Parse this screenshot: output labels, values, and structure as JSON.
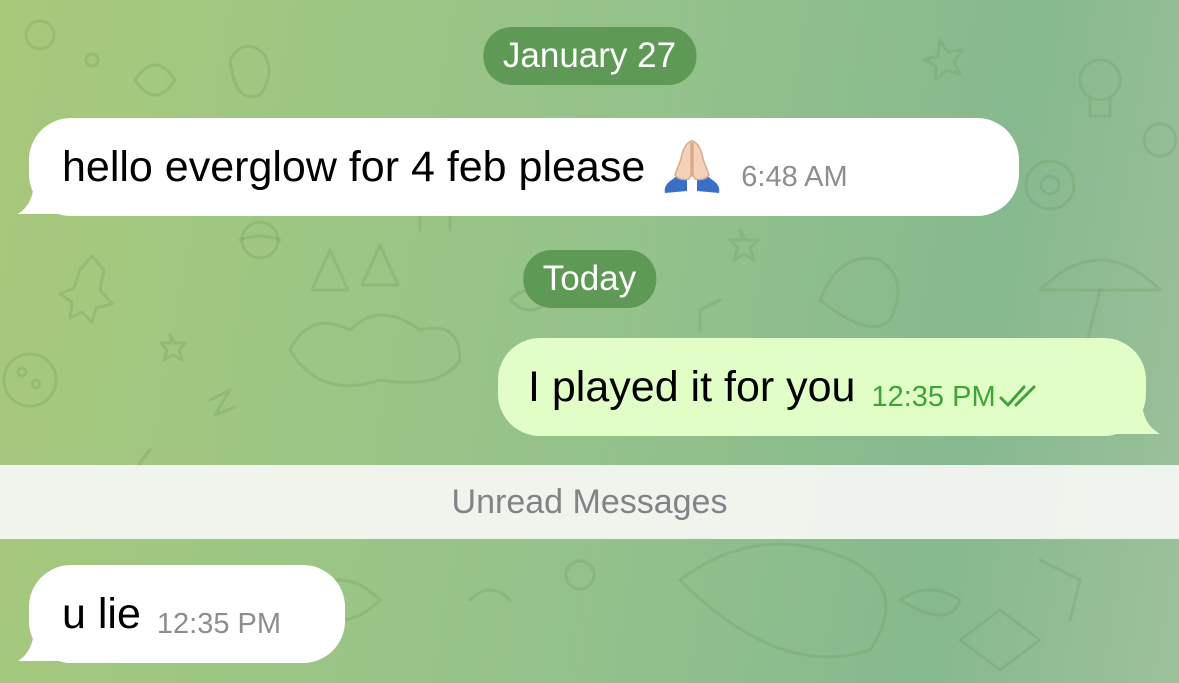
{
  "chat": {
    "date_separators": [
      "January 27",
      "Today"
    ],
    "messages": [
      {
        "direction": "incoming",
        "text": "hello everglow for 4 feb please",
        "emoji": "folded-hands",
        "time": "6:48 AM"
      },
      {
        "direction": "outgoing",
        "text": "I played it for you",
        "time": "12:35 PM",
        "status": "read"
      },
      {
        "direction": "incoming",
        "text": "u lie",
        "time": "12:35 PM"
      }
    ],
    "unread_divider": "Unread Messages"
  },
  "colors": {
    "date_pill": "#5e9a56",
    "incoming_bubble": "#ffffff",
    "outgoing_bubble": "#e1fec6",
    "outgoing_meta": "#3ea43a",
    "incoming_meta": "#8d8e92"
  }
}
